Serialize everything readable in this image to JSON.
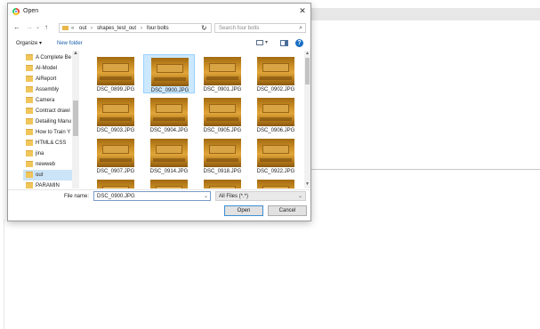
{
  "dialog": {
    "title": "Open",
    "close_glyph": "✕",
    "nav": {
      "back": "←",
      "forward": "→",
      "dropdown": "⌄",
      "up": "↑"
    },
    "breadcrumb": [
      "«",
      "out",
      "›",
      "shapes_test_out",
      "›",
      "four bolts"
    ],
    "address_dropdown": "⌄",
    "refresh": "↻",
    "search_placeholder": "Search four bolts",
    "search_icon": "⌕",
    "toolbar": {
      "organize": "Organize ▾",
      "new_folder": "New folder",
      "view_dropdown": "▾",
      "help": "?"
    },
    "nav_items": [
      {
        "label": "A Complete Be",
        "selected": false
      },
      {
        "label": "AI-Model",
        "selected": false
      },
      {
        "label": "AiReport",
        "selected": false
      },
      {
        "label": "Assembly",
        "selected": false
      },
      {
        "label": "Camera",
        "selected": false
      },
      {
        "label": "Contract drawi",
        "selected": false
      },
      {
        "label": "Detailing Manu",
        "selected": false
      },
      {
        "label": "How to Train Y",
        "selected": false
      },
      {
        "label": "HTML& CSS",
        "selected": false
      },
      {
        "label": "jina",
        "selected": false
      },
      {
        "label": "newweb",
        "selected": false
      },
      {
        "label": "out",
        "selected": true
      },
      {
        "label": "PARAMIN",
        "selected": false
      }
    ],
    "files": [
      {
        "name": "DSC_0899.JPG",
        "selected": false
      },
      {
        "name": "DSC_0900.JPG",
        "selected": true
      },
      {
        "name": "DSC_0901.JPG",
        "selected": false
      },
      {
        "name": "DSC_0902.JPG",
        "selected": false
      },
      {
        "name": "DSC_0903.JPG",
        "selected": false
      },
      {
        "name": "DSC_0904.JPG",
        "selected": false
      },
      {
        "name": "DSC_0905.JPG",
        "selected": false
      },
      {
        "name": "DSC_0906.JPG",
        "selected": false
      },
      {
        "name": "DSC_0907.JPG",
        "selected": false
      },
      {
        "name": "DSC_0914.JPG",
        "selected": false
      },
      {
        "name": "DSC_0918.JPG",
        "selected": false
      },
      {
        "name": "DSC_0922.JPG",
        "selected": false
      },
      {
        "name": "",
        "selected": false
      },
      {
        "name": "",
        "selected": false
      },
      {
        "name": "",
        "selected": false
      },
      {
        "name": "",
        "selected": false
      }
    ],
    "file_name_label": "File name:",
    "file_name_value": "DSC_0900.JPG",
    "file_type_value": "All Files (*.*)",
    "dropdown_glyph": "⌄",
    "open_label": "Open",
    "cancel_label": "Cancel"
  }
}
